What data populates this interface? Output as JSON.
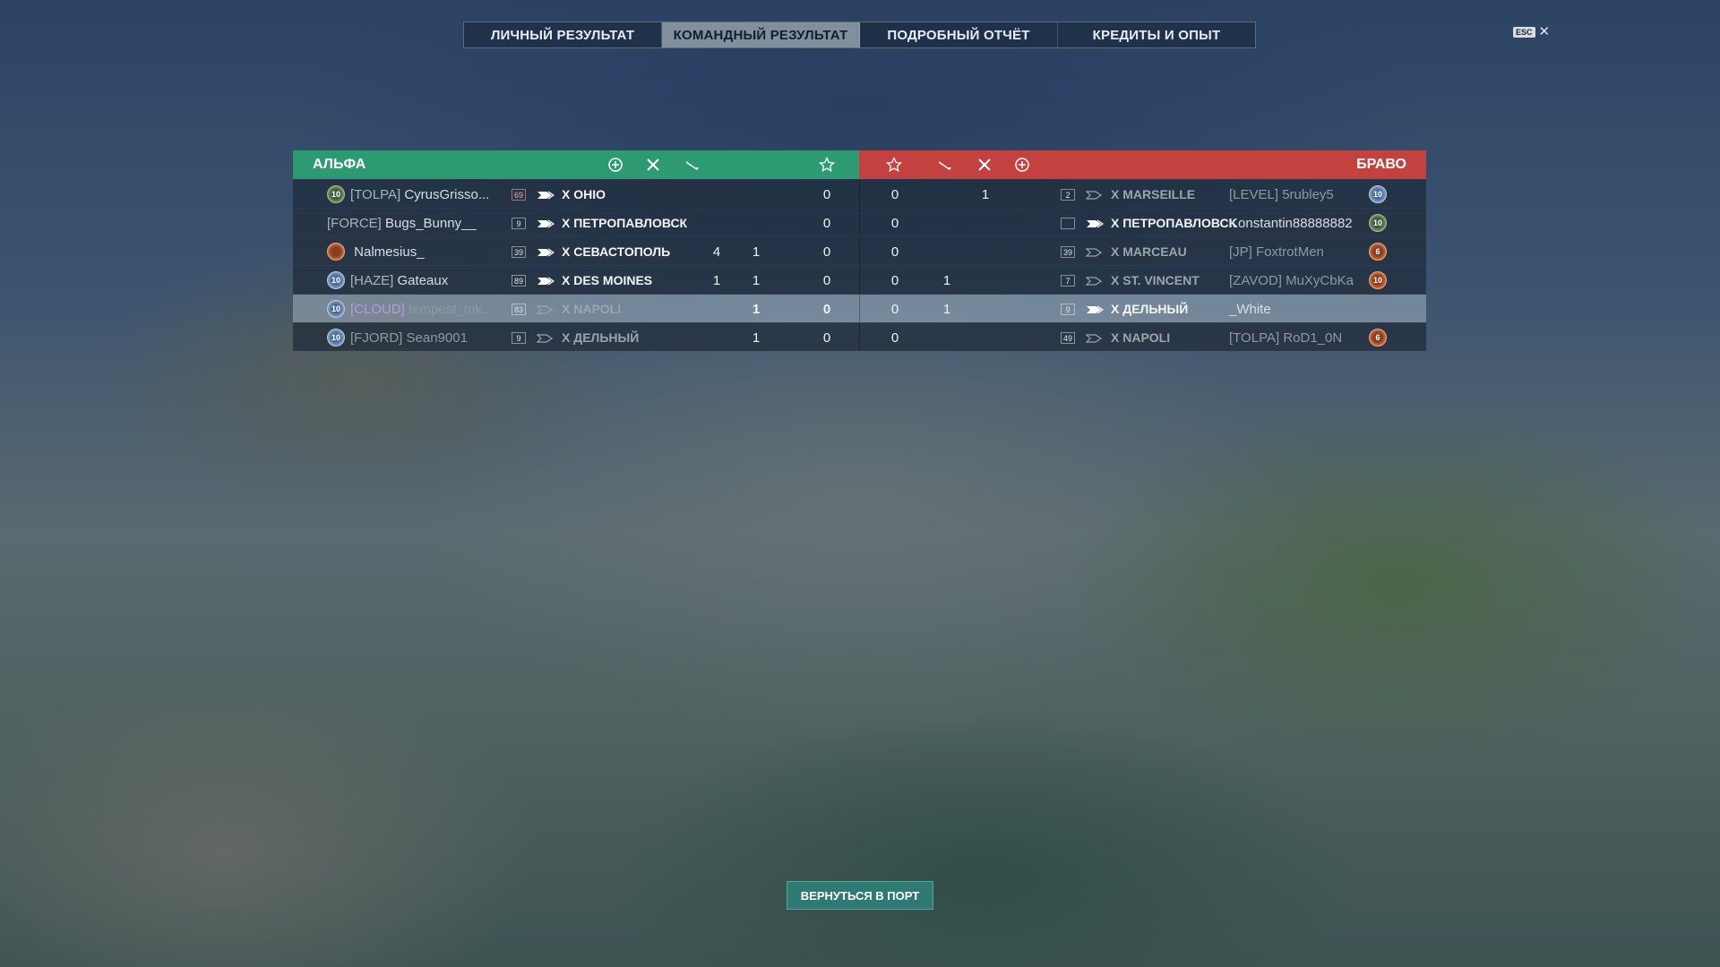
{
  "tabs": [
    {
      "label": "ЛИЧНЫЙ РЕЗУЛЬТАТ",
      "active": false
    },
    {
      "label": "КОМАНДНЫЙ РЕЗУЛЬТАТ",
      "active": true
    },
    {
      "label": "ПОДРОБНЫЙ ОТЧЁТ",
      "active": false
    },
    {
      "label": "КРЕДИТЫ И ОПЫТ",
      "active": false
    }
  ],
  "esc": {
    "badge": "ESC",
    "close": "✕"
  },
  "teams": {
    "alpha": {
      "name": "АЛЬФА",
      "color": "#2e9a72"
    },
    "bravo": {
      "name": "БРАВО",
      "color": "#c3423f"
    }
  },
  "columns_alpha": [
    "base-capture-icon",
    "kills-icon",
    "planes-icon",
    "star-icon"
  ],
  "columns_bravo": [
    "star-icon",
    "planes-icon",
    "kills-icon",
    "base-capture-icon"
  ],
  "rows": [
    {
      "alpha": {
        "rank": "10",
        "rank_color": "green",
        "clan": "[TOLPA]",
        "name": "CyrusGrisso...",
        "lvl": "69",
        "lvl_red": true,
        "ship": "X OHIO",
        "ship_filled": true,
        "captures": "",
        "kills": "",
        "planes": "",
        "xp": "0"
      },
      "bravo": {
        "xp": "0",
        "planes": "",
        "kills": "1",
        "captures": "",
        "lvl": "2",
        "ship": "X MARSEILLE",
        "ship_filled": false,
        "clan": "[LEVEL]",
        "name": "5rubley5",
        "rank": "10",
        "rank_color": "blue",
        "dim": true
      }
    },
    {
      "alpha": {
        "rank": "",
        "rank_color": "",
        "clan": "[FORCE]",
        "name": "Bugs_Bunny__",
        "lvl": "9",
        "lvl_red": false,
        "ship": "X ПЕТРОПАВЛОВСК",
        "ship_filled": true,
        "captures": "",
        "kills": "",
        "planes": "",
        "xp": "0"
      },
      "bravo": {
        "xp": "0",
        "planes": "",
        "kills": "",
        "captures": "",
        "lvl": "",
        "ship": "X ПЕТРОПАВЛОВСК",
        "ship_filled": true,
        "clan": "",
        "name": "Konstantin88888882",
        "rank": "10",
        "rank_color": "green",
        "dim": false
      }
    },
    {
      "alpha": {
        "rank": "",
        "rank_color": "orange",
        "clan": "",
        "name": "Nalmesius_",
        "lvl": "39",
        "lvl_red": false,
        "ship": "X СЕВАСТОПОЛЬ",
        "ship_filled": true,
        "captures": "",
        "kills": "4",
        "planes": "1",
        "xp": "0"
      },
      "bravo": {
        "xp": "0",
        "planes": "",
        "kills": "",
        "captures": "",
        "lvl": "39",
        "ship": "X MARCEAU",
        "ship_filled": false,
        "clan": "[JP]",
        "name": "FoxtrotMen",
        "rank": "6",
        "rank_color": "orange",
        "dim": true
      }
    },
    {
      "alpha": {
        "rank": "10",
        "rank_color": "blue",
        "clan": "[HAZE]",
        "name": "Gateaux",
        "lvl": "89",
        "lvl_red": false,
        "ship": "X DES MOINES",
        "ship_filled": true,
        "captures": "",
        "kills": "1",
        "planes": "1",
        "xp": "0"
      },
      "bravo": {
        "xp": "0",
        "planes": "1",
        "kills": "",
        "captures": "",
        "lvl": "7",
        "ship": "X ST. VINCENT",
        "ship_filled": false,
        "clan": "[ZAVOD]",
        "name": "MuXyCbKa",
        "rank": "10",
        "rank_color": "orange",
        "dim": true
      }
    },
    {
      "alpha": {
        "rank": "10",
        "rank_color": "blue",
        "clan": "[CLOUD]",
        "name": "tempest_mk...",
        "lvl": "83",
        "lvl_red": false,
        "ship": "X NAPOLI",
        "ship_filled": false,
        "captures": "",
        "kills": "",
        "planes": "1",
        "xp": "0",
        "highlight": true
      },
      "bravo": {
        "xp": "0",
        "planes": "1",
        "kills": "",
        "captures": "",
        "lvl": "9",
        "ship": "X ДЕЛЬНЫЙ",
        "ship_filled": true,
        "clan": "",
        "name": "_White",
        "rank": "",
        "rank_color": "",
        "dim": false
      }
    },
    {
      "alpha": {
        "rank": "10",
        "rank_color": "blue",
        "clan": "[FJORD]",
        "name": "Sean9001",
        "lvl": "9",
        "lvl_red": false,
        "ship": "X ДЕЛЬНЫЙ",
        "ship_filled": false,
        "captures": "",
        "kills": "",
        "planes": "1",
        "xp": "0",
        "dim": true
      },
      "bravo": {
        "xp": "0",
        "planes": "",
        "kills": "",
        "captures": "",
        "lvl": "49",
        "ship": "X NAPOLI",
        "ship_filled": false,
        "clan": "[TOLPA]",
        "name": "RoD1_0N",
        "rank": "6",
        "rank_color": "orange",
        "dim": true
      }
    }
  ],
  "return_button": "ВЕРНУТЬСЯ В ПОРТ"
}
